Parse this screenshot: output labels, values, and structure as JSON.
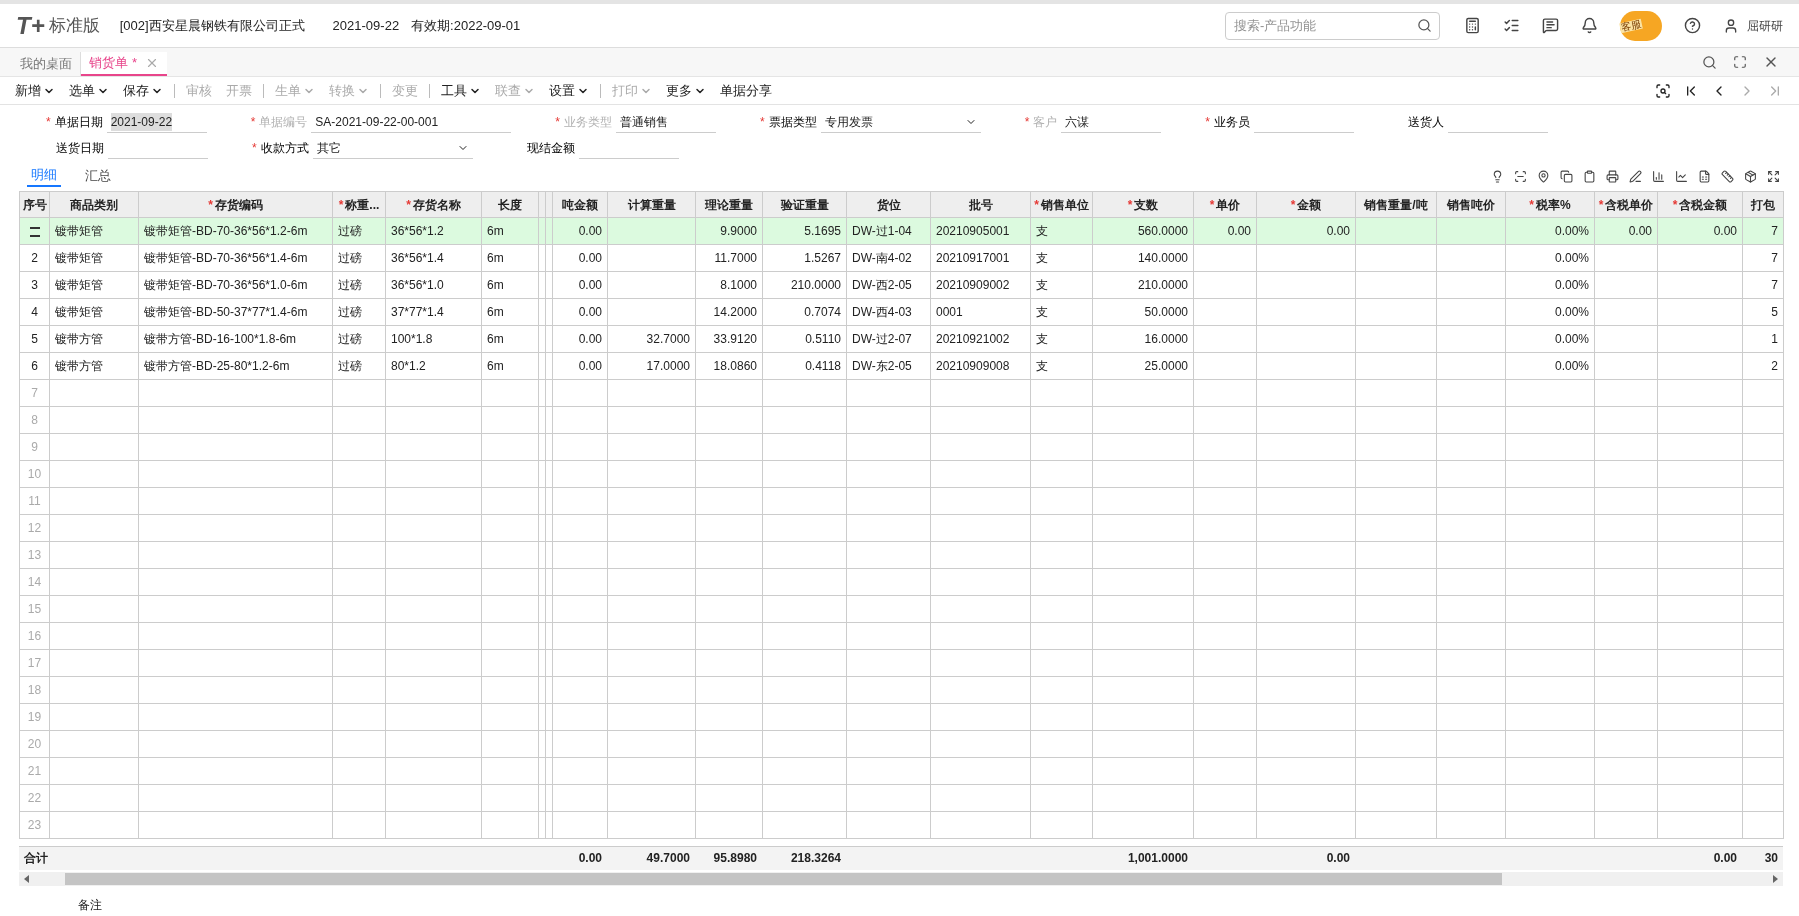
{
  "header": {
    "logo_mark": "T+",
    "product": "标准版",
    "company": "[002]西安星晨钢铁有限公司正式",
    "date": "2021-09-22",
    "validity": "有效期:2022-09-01",
    "search": {
      "placeholder": "搜索-产品功能"
    },
    "support_badge": "客服",
    "user": "屈研研"
  },
  "tabs": [
    {
      "label": "我的桌面",
      "selected": false,
      "modified": false,
      "closable": false
    },
    {
      "label": "销货单",
      "selected": true,
      "modified": true,
      "closable": true
    }
  ],
  "modified_marker": "*",
  "required_marker": "*",
  "toolbar": [
    {
      "label": "新增",
      "menu": true,
      "disabled": false
    },
    {
      "label": "选单",
      "menu": true,
      "disabled": false
    },
    {
      "label": "保存",
      "menu": true,
      "disabled": false
    },
    {
      "label": "审核",
      "menu": false,
      "disabled": true,
      "divider": true
    },
    {
      "label": "开票",
      "menu": false,
      "disabled": true
    },
    {
      "label": "生单",
      "menu": true,
      "disabled": true,
      "divider": true
    },
    {
      "label": "转换",
      "menu": true,
      "disabled": true
    },
    {
      "label": "变更",
      "menu": false,
      "disabled": true,
      "divider": true
    },
    {
      "label": "工具",
      "menu": true,
      "disabled": false,
      "divider": true
    },
    {
      "label": "联查",
      "menu": true,
      "disabled": true
    },
    {
      "label": "设置",
      "menu": true,
      "disabled": false
    },
    {
      "label": "打印",
      "menu": true,
      "disabled": true,
      "divider": true
    },
    {
      "label": "更多",
      "menu": true,
      "disabled": false
    },
    {
      "label": "单据分享",
      "menu": false,
      "disabled": false
    }
  ],
  "form_rows": [
    [
      {
        "label": "单据日期",
        "required": true,
        "disabled": false,
        "value": "2021-09-22",
        "highlighted": true,
        "kind": "text"
      },
      {
        "label": "单据编号",
        "required": true,
        "disabled": true,
        "value": "SA-2021-09-22-00-001",
        "kind": "text"
      },
      {
        "label": "业务类型",
        "required": true,
        "disabled": true,
        "value": "普通销售",
        "kind": "text"
      },
      {
        "label": "票据类型",
        "required": true,
        "disabled": false,
        "value": "专用发票",
        "kind": "select"
      },
      {
        "label": "客户",
        "required": true,
        "disabled": true,
        "value": "六谋",
        "kind": "text"
      },
      {
        "label": "业务员",
        "required": true,
        "disabled": false,
        "kind": "text"
      },
      {
        "label": "送货人",
        "required": false,
        "disabled": false,
        "kind": "text"
      }
    ],
    [
      {
        "label": "送货日期",
        "required": false,
        "disabled": false,
        "kind": "text"
      },
      {
        "label": "收款方式",
        "required": true,
        "disabled": false,
        "value": "其它",
        "kind": "select"
      },
      {
        "label": "现结金额",
        "required": false,
        "disabled": false,
        "kind": "text"
      }
    ]
  ],
  "sub_tabs": [
    {
      "label": "明细",
      "selected": true
    },
    {
      "label": "汇总",
      "selected": false
    }
  ],
  "table": {
    "columns": [
      {
        "label": "序号",
        "required": false,
        "kind": "text"
      },
      {
        "label": "商品类别",
        "required": false,
        "kind": "text"
      },
      {
        "label": "存货编码",
        "required": true,
        "kind": "text"
      },
      {
        "label": "称重...",
        "required": true,
        "kind": "text"
      },
      {
        "label": "存货名称",
        "required": true,
        "kind": "text"
      },
      {
        "label": "长度",
        "required": false,
        "kind": "text"
      },
      {
        "kind": "text"
      },
      {
        "kind": "text"
      },
      {
        "label": "吨金额",
        "required": false,
        "kind": "number"
      },
      {
        "label": "计算重量",
        "required": false,
        "kind": "number"
      },
      {
        "label": "理论重量",
        "required": false,
        "kind": "number"
      },
      {
        "label": "验证重量",
        "required": false,
        "kind": "number"
      },
      {
        "label": "货位",
        "required": false,
        "kind": "text"
      },
      {
        "label": "批号",
        "required": false,
        "kind": "text"
      },
      {
        "label": "销售单位",
        "required": true,
        "kind": "text"
      },
      {
        "label": "支数",
        "required": true,
        "kind": "number"
      },
      {
        "label": "单价",
        "required": true,
        "kind": "number"
      },
      {
        "label": "金额",
        "required": true,
        "kind": "number"
      },
      {
        "label": "销售重量/吨",
        "required": false,
        "kind": "number"
      },
      {
        "label": "销售吨价",
        "required": false,
        "kind": "number"
      },
      {
        "label": "税率%",
        "required": true,
        "kind": "number"
      },
      {
        "label": "含税单价",
        "required": true,
        "kind": "number"
      },
      {
        "label": "含税金额",
        "required": true,
        "kind": "number"
      },
      {
        "label": "打包",
        "required": false,
        "kind": "number"
      }
    ],
    "rows": [
      {
        "selected": true,
        "category": "镀带矩管",
        "code": "镀带矩管-BD-70-36*56*1.2-6m",
        "weighing": "过磅",
        "name": "36*56*1.2",
        "length": "6m",
        "ton_amount": "0.00",
        "theory_weight": "9.9000",
        "check_weight": "5.1695",
        "location": "DW-过1-04",
        "batch": "20210905001",
        "unit": "支",
        "pieces": "560.0000",
        "price": "0.00",
        "amount": "0.00",
        "tax_rate": "0.00%",
        "tax_price": "0.00",
        "tax_amount": "0.00",
        "pack": "7"
      },
      {
        "selected": false,
        "seq": "2",
        "category": "镀带矩管",
        "code": "镀带矩管-BD-70-36*56*1.4-6m",
        "weighing": "过磅",
        "name": "36*56*1.4",
        "length": "6m",
        "ton_amount": "0.00",
        "theory_weight": "11.7000",
        "check_weight": "1.5267",
        "location": "DW-南4-02",
        "batch": "20210917001",
        "unit": "支",
        "pieces": "140.0000",
        "tax_rate": "0.00%",
        "pack": "7"
      },
      {
        "selected": false,
        "seq": "3",
        "category": "镀带矩管",
        "code": "镀带矩管-BD-70-36*56*1.0-6m",
        "weighing": "过磅",
        "name": "36*56*1.0",
        "length": "6m",
        "ton_amount": "0.00",
        "theory_weight": "8.1000",
        "check_weight": "210.0000",
        "location": "DW-西2-05",
        "batch": "20210909002",
        "unit": "支",
        "pieces": "210.0000",
        "tax_rate": "0.00%",
        "pack": "7"
      },
      {
        "selected": false,
        "seq": "4",
        "category": "镀带矩管",
        "code": "镀带矩管-BD-50-37*77*1.4-6m",
        "weighing": "过磅",
        "name": "37*77*1.4",
        "length": "6m",
        "ton_amount": "0.00",
        "theory_weight": "14.2000",
        "check_weight": "0.7074",
        "location": "DW-西4-03",
        "batch": "0001",
        "unit": "支",
        "pieces": "50.0000",
        "tax_rate": "0.00%",
        "pack": "5"
      },
      {
        "selected": false,
        "seq": "5",
        "category": "镀带方管",
        "code": "镀带方管-BD-16-100*1.8-6m",
        "weighing": "过磅",
        "name": "100*1.8",
        "length": "6m",
        "ton_amount": "0.00",
        "calc_weight": "32.7000",
        "theory_weight": "33.9120",
        "check_weight": "0.5110",
        "location": "DW-过2-07",
        "batch": "20210921002",
        "unit": "支",
        "pieces": "16.0000",
        "tax_rate": "0.00%",
        "pack": "1"
      },
      {
        "selected": false,
        "seq": "6",
        "category": "镀带方管",
        "code": "镀带方管-BD-25-80*1.2-6m",
        "weighing": "过磅",
        "name": "80*1.2",
        "length": "6m",
        "ton_amount": "0.00",
        "calc_weight": "17.0000",
        "theory_weight": "18.0860",
        "check_weight": "0.4118",
        "location": "DW-东2-05",
        "batch": "20210909008",
        "unit": "支",
        "pieces": "25.0000",
        "tax_rate": "0.00%",
        "pack": "2"
      },
      {
        "selected": false,
        "seq": "7"
      },
      {
        "selected": false,
        "seq": "8"
      },
      {
        "selected": false,
        "seq": "9"
      },
      {
        "selected": false,
        "seq": "10"
      },
      {
        "selected": false,
        "seq": "11"
      },
      {
        "selected": false,
        "seq": "12"
      },
      {
        "selected": false,
        "seq": "13"
      },
      {
        "selected": false,
        "seq": "14"
      },
      {
        "selected": false,
        "seq": "15"
      },
      {
        "selected": false,
        "seq": "16"
      },
      {
        "selected": false,
        "seq": "17"
      },
      {
        "selected": false,
        "seq": "18"
      },
      {
        "selected": false,
        "seq": "19"
      },
      {
        "selected": false,
        "seq": "20"
      },
      {
        "selected": false,
        "seq": "21"
      },
      {
        "selected": false,
        "seq": "22"
      },
      {
        "selected": false,
        "seq": "23"
      }
    ],
    "totals": {
      "seq": "合计",
      "ton_amount": "0.00",
      "calc_weight": "49.7000",
      "theory_weight": "95.8980",
      "check_weight": "218.3264",
      "pieces": "1,001.0000",
      "amount": "0.00",
      "tax_amount": "0.00",
      "pack": "30"
    }
  },
  "remark_label": "备注"
}
